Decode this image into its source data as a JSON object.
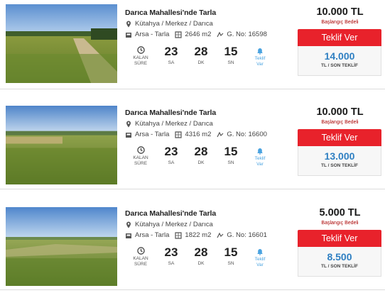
{
  "listings": [
    {
      "title": "Darıca Mahallesi'nde Tarla",
      "location": "Kütahya / Merkez / Darıca",
      "type": "Arsa - Tarla",
      "area": "2646 m2",
      "parcel": "G. No: 16598",
      "countdown": {
        "days": "23",
        "hours": "28",
        "minutes": "15"
      },
      "price": "10.000 TL",
      "current_bid": "14.000"
    },
    {
      "title": "Darıca Mahallesi'nde Tarla",
      "location": "Kütahya / Merkez / Darıca",
      "type": "Arsa - Tarla",
      "area": "4316 m2",
      "parcel": "G. No: 16600",
      "countdown": {
        "days": "23",
        "hours": "28",
        "minutes": "15"
      },
      "price": "10.000 TL",
      "current_bid": "13.000"
    },
    {
      "title": "Darıca Mahallesi'nde Tarla",
      "location": "Kütahya / Merkez / Darıca",
      "type": "Arsa - Tarla",
      "area": "1822 m2",
      "parcel": "G. No: 16601",
      "countdown": {
        "days": "23",
        "hours": "28",
        "minutes": "15"
      },
      "price": "5.000 TL",
      "current_bid": "8.500"
    }
  ],
  "labels": {
    "remaining": "KALAN",
    "time": "SÜRE",
    "days_unit": "SA",
    "hours_unit": "DK",
    "minutes_unit": "SN",
    "notify_line1": "Teklif",
    "notify_line2": "Var",
    "starting_price": "Başlangıç Bedeli",
    "bid_button": "Teklif Ver",
    "last_bid": "TL / SON TEKLİF"
  },
  "colors": {
    "bid_button": "#e8222b",
    "bid_value": "#2e7fc2",
    "notify": "#4aa3e0"
  }
}
